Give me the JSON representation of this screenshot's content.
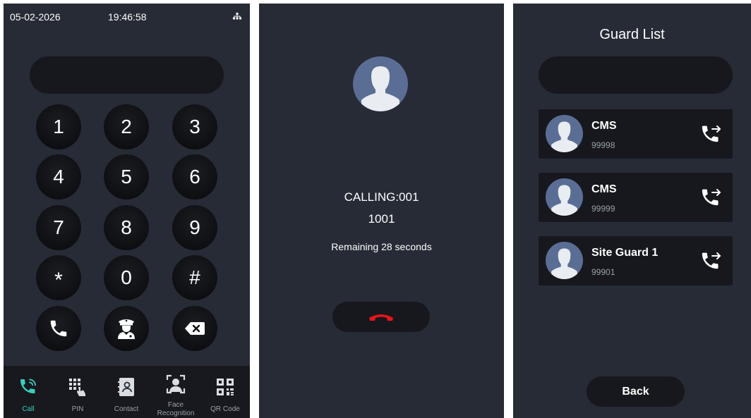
{
  "dialer": {
    "status": {
      "date": "05-02-2026",
      "time": "19:46:58",
      "network_icon": "network-icon"
    },
    "keys": [
      "1",
      "2",
      "3",
      "4",
      "5",
      "6",
      "7",
      "8",
      "9",
      "*",
      "0",
      "#"
    ],
    "actions": {
      "call_icon": "phone-icon",
      "guard_icon": "security-guard-icon",
      "delete_icon": "backspace-icon"
    },
    "nav": [
      {
        "label": "Call",
        "icon": "call-icon",
        "active": true
      },
      {
        "label": "PIN",
        "icon": "pin-keypad-icon",
        "active": false
      },
      {
        "label": "Contact",
        "icon": "contact-icon",
        "active": false
      },
      {
        "label": "Face",
        "label2": "Recognition",
        "icon": "face-recognition-icon",
        "active": false
      },
      {
        "label": "QR Code",
        "icon": "qr-code-icon",
        "active": false
      }
    ]
  },
  "calling": {
    "target": "CALLING:001",
    "number": "1001",
    "remaining": "Remaining 28 seconds",
    "hangup_icon": "hang-up-icon"
  },
  "guards": {
    "title": "Guard List",
    "items": [
      {
        "name": "CMS",
        "number": "99998"
      },
      {
        "name": "CMS",
        "number": "99999"
      },
      {
        "name": "Site Guard 1",
        "number": "99901"
      }
    ],
    "back_label": "Back"
  },
  "colors": {
    "background": "#262b35",
    "panel_dark": "#16181d",
    "accent": "#37d0be",
    "hangup": "#e8141b",
    "avatar": "#5a6d94"
  }
}
